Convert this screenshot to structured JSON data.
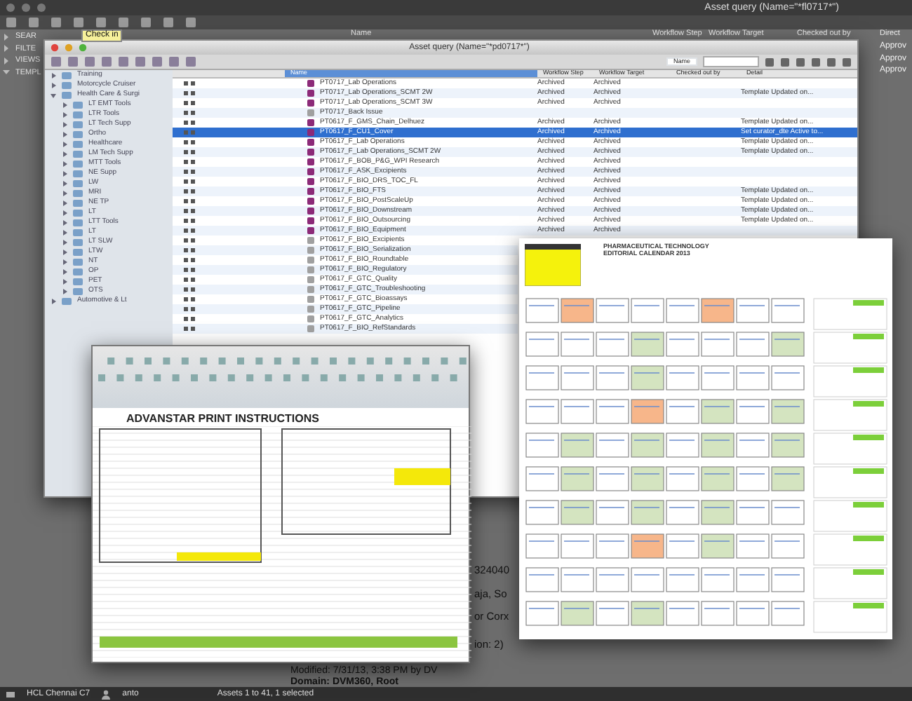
{
  "app": {
    "title": "Asset query (Name=\"*fl0717*\")",
    "tooltip": "Check in",
    "sidebar": [
      {
        "label": "SEAR",
        "expanded": false
      },
      {
        "label": "FILTE",
        "expanded": false
      },
      {
        "label": "VIEWS",
        "expanded": false
      },
      {
        "label": "TEMPL",
        "expanded": true
      }
    ],
    "columns": [
      "Name",
      "Workflow Step",
      "Workflow Target",
      "Checked out by",
      "Direct"
    ],
    "direction_values": [
      "Approv",
      "Approv",
      "Approv"
    ],
    "details": [
      "324040",
      "aja, So",
      "or Corx",
      "ion: 2)"
    ],
    "modified": "Modified: 7/31/13, 3:38 PM by DV",
    "domain": "Domain: DVM360, Root",
    "status_bar": {
      "server": "HCL Chennai C7",
      "user": "anto",
      "count": "Assets 1 to 41, 1 selected"
    }
  },
  "query_window": {
    "title": "Asset query (Name=\"*pd0717*\")",
    "search_scope": "Name",
    "tree": [
      {
        "label": "Training",
        "expanded": false
      },
      {
        "label": "Motorcycle Cruiser",
        "expanded": false
      },
      {
        "label": "Health Care & Surgi",
        "expanded": true,
        "children": [
          {
            "label": "LT EMT Tools"
          },
          {
            "label": "LTR Tools"
          },
          {
            "label": "LT Tech Supp"
          },
          {
            "label": "Ortho"
          },
          {
            "label": "Healthcare"
          },
          {
            "label": "LM Tech Supp"
          },
          {
            "label": "MTT Tools"
          },
          {
            "label": "NE Supp"
          },
          {
            "label": "LW"
          },
          {
            "label": "MRI"
          },
          {
            "label": "NE TP"
          },
          {
            "label": "LT"
          },
          {
            "label": "LTT Tools"
          },
          {
            "label": "LT"
          },
          {
            "label": "LT SLW"
          },
          {
            "label": "LTW"
          },
          {
            "label": "NT"
          },
          {
            "label": "OP"
          },
          {
            "label": "PET"
          },
          {
            "label": "OTS"
          }
        ]
      },
      {
        "label": "Automotive & Lt",
        "expanded": false
      }
    ],
    "columns": [
      "Name",
      "Workflow Step",
      "Workflow Target",
      "Checked out by",
      "Detail"
    ],
    "rows": [
      {
        "name": "PT0717_Lab Operations",
        "step": "Archived",
        "target": "Archived",
        "selected": false
      },
      {
        "name": "PT0717_Lab Operations_SCMT 2W",
        "step": "Archived",
        "target": "Archived",
        "detail": "Template Updated on...",
        "selected": false
      },
      {
        "name": "PT0717_Lab Operations_SCMT 3W",
        "step": "Archived",
        "target": "Archived",
        "selected": false
      },
      {
        "name": "PT0717_Back Issue",
        "selected": false
      },
      {
        "name": "PT0617_F_GMS_Chain_Delhuez",
        "step": "Archived",
        "target": "Archived",
        "detail": "Template Updated on...",
        "selected": false
      },
      {
        "name": "PT0617_F_CU1_Cover",
        "step": "Archived",
        "target": "Archived",
        "detail": "Set curator_dte Active to...",
        "selected": true
      },
      {
        "name": "PT0617_F_Lab Operations",
        "step": "Archived",
        "target": "Archived",
        "detail": "Template Updated on...",
        "selected": false
      },
      {
        "name": "PT0617_F_Lab Operations_SCMT 2W",
        "step": "Archived",
        "target": "Archived",
        "detail": "Template Updated on...",
        "selected": false
      },
      {
        "name": "PT0617_F_BOB_P&G_WPI Research",
        "step": "Archived",
        "target": "Archived",
        "selected": false
      },
      {
        "name": "PT0617_F_ASK_Excipients",
        "step": "Archived",
        "target": "Archived",
        "selected": false
      },
      {
        "name": "PT0617_F_BIO_DRS_TOC_FL",
        "step": "Archived",
        "target": "Archived",
        "selected": false
      },
      {
        "name": "PT0617_F_BIO_FTS",
        "step": "Archived",
        "target": "Archived",
        "detail": "Template Updated on...",
        "selected": false
      },
      {
        "name": "PT0617_F_BIO_PostScaleUp",
        "step": "Archived",
        "target": "Archived",
        "detail": "Template Updated on...",
        "selected": false
      },
      {
        "name": "PT0617_F_BIO_Downstream",
        "step": "Archived",
        "target": "Archived",
        "detail": "Template Updated on...",
        "selected": false
      },
      {
        "name": "PT0617_F_BIO_Outsourcing",
        "step": "Archived",
        "target": "Archived",
        "detail": "Template Updated on...",
        "selected": false
      },
      {
        "name": "PT0617_F_BIO_Equipment",
        "step": "Archived",
        "target": "Archived",
        "selected": false
      },
      {
        "name": "PT0617_F_BIO_Excipients",
        "selected": false
      },
      {
        "name": "PT0617_F_BIO_Serialization",
        "selected": false
      },
      {
        "name": "PT0617_F_BIO_Roundtable",
        "selected": false
      },
      {
        "name": "PT0617_F_BIO_Regulatory",
        "selected": false
      },
      {
        "name": "PT0617_F_GTC_Quality",
        "selected": false
      },
      {
        "name": "PT0617_F_GTC_Troubleshooting",
        "selected": false
      },
      {
        "name": "PT0617_F_GTC_Bioassays",
        "selected": false
      },
      {
        "name": "PT0617_F_GTC_Pipeline",
        "selected": false
      },
      {
        "name": "PT0617_F_GTC_Analytics",
        "selected": false
      },
      {
        "name": "PT0617_F_BIO_RefStandards",
        "selected": false
      }
    ]
  },
  "spreadsheet": {
    "heading": "ADVANSTAR PRINT INSTRUCTIONS"
  },
  "calendar_page": {
    "title": "PHARMACEUTICAL TECHNOLOGY",
    "subtitle": "EDITORIAL CALENDAR 2013",
    "weeks": [
      {
        "cells": [
          {
            "color": "#ffffff"
          },
          {
            "color": "#f7b68a"
          },
          {
            "color": "#ffffff"
          },
          {
            "color": "#ffffff"
          },
          {
            "color": "#ffffff"
          },
          {
            "color": "#f7b68a"
          },
          {
            "color": "#ffffff"
          },
          {
            "color": "#ffffff"
          }
        ]
      },
      {
        "cells": [
          {
            "color": "#ffffff"
          },
          {
            "color": "#ffffff"
          },
          {
            "color": "#ffffff"
          },
          {
            "color": "#d4e4c0"
          },
          {
            "color": "#ffffff"
          },
          {
            "color": "#ffffff"
          },
          {
            "color": "#ffffff"
          },
          {
            "color": "#d4e4c0"
          }
        ]
      },
      {
        "cells": [
          {
            "color": "#ffffff"
          },
          {
            "color": "#ffffff"
          },
          {
            "color": "#ffffff"
          },
          {
            "color": "#d4e4c0"
          },
          {
            "color": "#ffffff"
          },
          {
            "color": "#ffffff"
          },
          {
            "color": "#ffffff"
          },
          {
            "color": "#ffffff"
          }
        ]
      },
      {
        "cells": [
          {
            "color": "#ffffff"
          },
          {
            "color": "#ffffff"
          },
          {
            "color": "#ffffff"
          },
          {
            "color": "#f7b68a"
          },
          {
            "color": "#ffffff"
          },
          {
            "color": "#d4e4c0"
          },
          {
            "color": "#ffffff"
          },
          {
            "color": "#d4e4c0"
          }
        ]
      },
      {
        "cells": [
          {
            "color": "#ffffff"
          },
          {
            "color": "#d4e4c0"
          },
          {
            "color": "#ffffff"
          },
          {
            "color": "#d4e4c0"
          },
          {
            "color": "#ffffff"
          },
          {
            "color": "#d4e4c0"
          },
          {
            "color": "#ffffff"
          },
          {
            "color": "#d4e4c0"
          }
        ]
      },
      {
        "cells": [
          {
            "color": "#ffffff"
          },
          {
            "color": "#d4e4c0"
          },
          {
            "color": "#ffffff"
          },
          {
            "color": "#d4e4c0"
          },
          {
            "color": "#ffffff"
          },
          {
            "color": "#d4e4c0"
          },
          {
            "color": "#ffffff"
          },
          {
            "color": "#d4e4c0"
          }
        ]
      },
      {
        "cells": [
          {
            "color": "#ffffff"
          },
          {
            "color": "#d4e4c0"
          },
          {
            "color": "#ffffff"
          },
          {
            "color": "#d4e4c0"
          },
          {
            "color": "#ffffff"
          },
          {
            "color": "#d4e4c0"
          },
          {
            "color": "#ffffff"
          },
          {
            "color": "#ffffff"
          }
        ]
      },
      {
        "cells": [
          {
            "color": "#ffffff"
          },
          {
            "color": "#ffffff"
          },
          {
            "color": "#ffffff"
          },
          {
            "color": "#f7b68a"
          },
          {
            "color": "#ffffff"
          },
          {
            "color": "#d4e4c0"
          },
          {
            "color": "#ffffff"
          },
          {
            "color": "#ffffff"
          }
        ]
      },
      {
        "cells": [
          {
            "color": "#ffffff"
          },
          {
            "color": "#ffffff"
          },
          {
            "color": "#ffffff"
          },
          {
            "color": "#ffffff"
          },
          {
            "color": "#ffffff"
          },
          {
            "color": "#ffffff"
          },
          {
            "color": "#ffffff"
          },
          {
            "color": "#ffffff"
          }
        ]
      },
      {
        "cells": [
          {
            "color": "#ffffff"
          },
          {
            "color": "#d4e4c0"
          },
          {
            "color": "#ffffff"
          },
          {
            "color": "#d4e4c0"
          },
          {
            "color": "#ffffff"
          },
          {
            "color": "#ffffff"
          },
          {
            "color": "#ffffff"
          },
          {
            "color": "#ffffff"
          }
        ]
      }
    ]
  }
}
